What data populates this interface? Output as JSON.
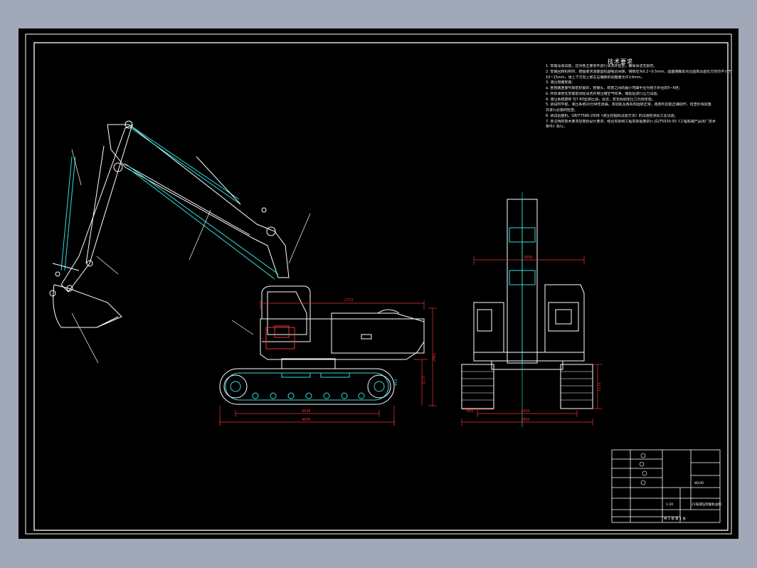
{
  "drawing": {
    "requirements_title": "技术要求",
    "requirements": [
      "1. 安装及调试前，应对各主要零件进行清洗并检查，确保清洁无损伤。",
      "2. 安装回转机构时，按图要求调整齿轮副啮合间隙，侧隙应为0.2~0.5mm，齿面接触斑点沿齿高及齿长方向均不小于",
      "   10~15mm，误上下方向上和左右偏移的调整量允许±4mm。",
      "3. 液压管路安装：",
      "   a. 各管路连接可靠密封良好，管接头、软管之间的最小弯曲半径为管子外径的5~6倍；",
      "   b. 所有油管在安装前须经清洗并用压缩空气吹净，装配后进行压力试验。",
      "4. 液压系统按照 YJ7-83型液压油，清洁，安全阀调定压力为规定值。",
      "5. 调试时平稳，液压系统20分钟无渗漏，发动机及各机构运转正常，各部件应能正确动作，检查外观完整",
      "   并进行必要的检查。",
      "6. 调试后整机，GB/T7586-2008《液压挖掘机试验方法》的试验检测及工业试验。",
      "7. 未注明的技术要求应按原设计要求，结合实际和工程实际需要执行 JG/T5030-93《工程机械产品出厂技术",
      "   条件》执行。"
    ],
    "dimensions": {
      "side_top_width": "2772",
      "side_height_total": "2961",
      "side_height_cab": "1175",
      "side_track_height": "915",
      "side_track_len": "3626",
      "side_overall_len": "4656",
      "front_track_gauge": "2000",
      "front_overall_width": "2800",
      "front_shoe_width": "600",
      "front_ground": "1175",
      "front_height": "3000"
    },
    "title_block": {
      "name": "21吨液压挖掘机总图",
      "drawing_no": "WJ-00",
      "scale": "1:20",
      "sheet": "共 1 张  第 1 张"
    }
  }
}
